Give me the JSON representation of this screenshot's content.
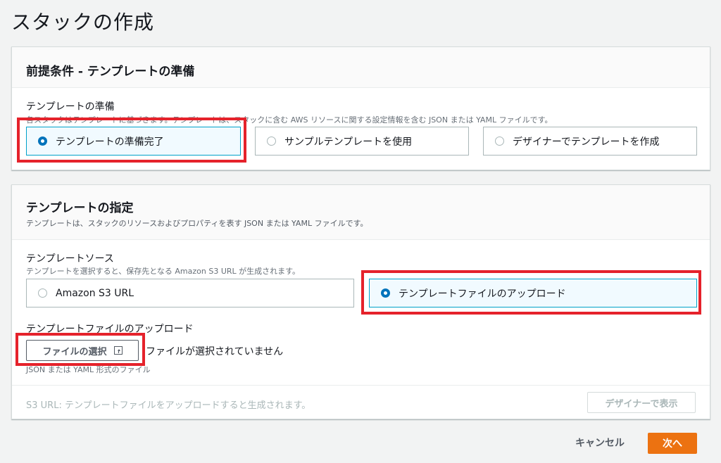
{
  "page": {
    "title": "スタックの作成"
  },
  "prereq": {
    "title": "前提条件 - テンプレートの準備",
    "field_label": "テンプレートの準備",
    "field_desc": "各スタックはテンプレートに基づきます。テンプレートは、スタックに含む AWS リソースに関する設定情報を含む JSON または YAML ファイルです。",
    "options": [
      {
        "label": "テンプレートの準備完了",
        "selected": true
      },
      {
        "label": "サンプルテンプレートを使用",
        "selected": false
      },
      {
        "label": "デザイナーでテンプレートを作成",
        "selected": false
      }
    ]
  },
  "spec": {
    "title": "テンプレートの指定",
    "desc": "テンプレートは、スタックのリソースおよびプロパティを表す JSON または YAML ファイルです。",
    "source_label": "テンプレートソース",
    "source_desc": "テンプレートを選択すると、保存先となる Amazon S3 URL が生成されます。",
    "sources": [
      {
        "label": "Amazon S3 URL",
        "selected": false
      },
      {
        "label": "テンプレートファイルのアップロード",
        "selected": true
      }
    ],
    "upload_label": "テンプレートファイルのアップロード",
    "file_button_label": "ファイルの選択",
    "no_file_text": "ファイルが選択されていません",
    "file_hint": "JSON または YAML 形式のファイル",
    "s3_url_text": "S3 URL:  テンプレートファイルをアップロードすると生成されます。",
    "designer_button_label": "デザイナーで表示"
  },
  "footer": {
    "cancel_label": "キャンセル",
    "next_label": "次へ"
  },
  "colors": {
    "accent": "#ec7211",
    "selected_border": "#00a1c9",
    "radio_selected": "#0073bb",
    "highlight": "#e5222b"
  }
}
